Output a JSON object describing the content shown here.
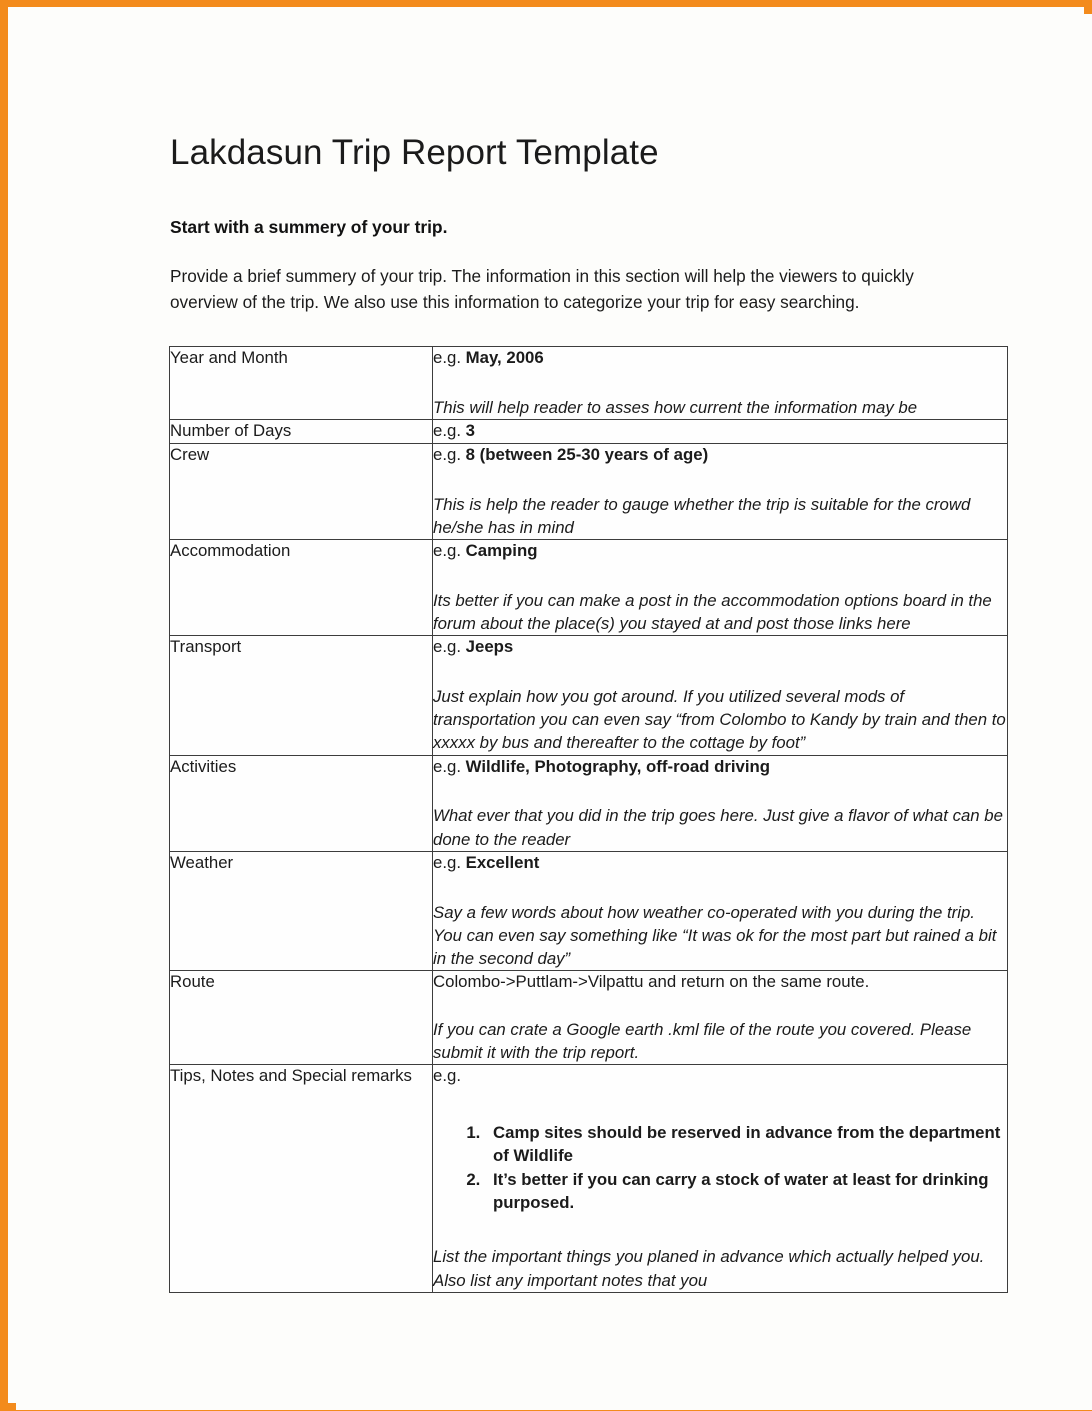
{
  "document": {
    "title": "Lakdasun Trip Report Template",
    "section_heading": "Start with a summery of your trip.",
    "intro_paragraph": "Provide a brief summery of your trip. The information in this section will help the viewers to quickly overview of the trip. We also use this information to categorize your trip for easy searching."
  },
  "border_color": "#f38b1c",
  "table": {
    "rows": [
      {
        "label": "Year and Month",
        "eg_prefix": "e.g. ",
        "eg_value": "May, 2006",
        "description": "This will help reader to asses how current the information may be"
      },
      {
        "label": "Number of Days",
        "eg_prefix": "e.g. ",
        "eg_value": "3",
        "description": ""
      },
      {
        "label": "Crew",
        "eg_prefix": "e.g. ",
        "eg_value": "8 (between 25-30 years of age)",
        "description": "This is help the reader to gauge whether the trip is suitable for the crowd he/she has in mind"
      },
      {
        "label": "Accommodation",
        "eg_prefix": "e.g. ",
        "eg_value": "Camping",
        "description": "Its better if you can make a post in the accommodation options board in the forum about the place(s) you stayed at and post those links here"
      },
      {
        "label": "Transport",
        "eg_prefix": "e.g. ",
        "eg_value": "Jeeps",
        "description": "Just explain how you got around. If you utilized several mods of transportation you can even say “from Colombo to Kandy by train and then to xxxxx by bus and thereafter to the cottage by foot”"
      },
      {
        "label": "Activities",
        "eg_prefix": "e.g. ",
        "eg_value": "Wildlife, Photography, off-road driving",
        "description": "What ever that you did in the trip goes here. Just give a flavor of what can be done to the reader"
      },
      {
        "label": "Weather",
        "eg_prefix": "e.g. ",
        "eg_value": "Excellent",
        "description": "Say a few words about how weather co-operated with you during the trip. You can even say something like “It was ok for the most part but rained a bit in the second day”"
      },
      {
        "label": "Route",
        "plain_value": "Colombo->Puttlam->Vilpattu and return on the same route.",
        "description": "If you can crate a Google earth .kml file of the route you covered. Please submit it with the trip report."
      },
      {
        "label": "Tips, Notes and Special remarks",
        "eg_prefix": "e.g.",
        "eg_value": "",
        "list": [
          "Camp sites should be reserved in advance from the department of Wildlife",
          "It’s better if you can carry a stock of water at least for drinking purposed."
        ],
        "description": "List the important things you planed in advance which actually helped you. Also list any important notes that you"
      }
    ]
  }
}
